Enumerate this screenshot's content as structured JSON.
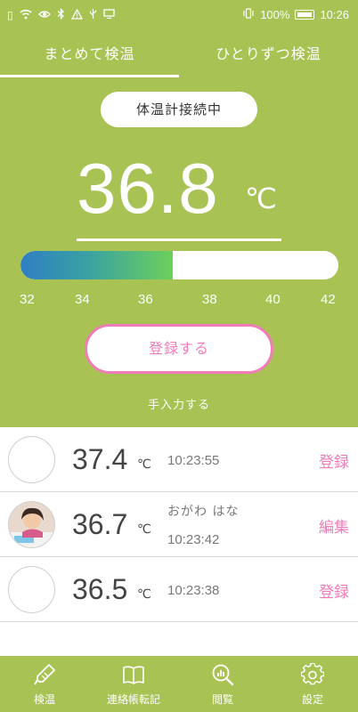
{
  "status_bar": {
    "battery": "100%",
    "time": "10:26",
    "left_icons": [
      "sim-icon",
      "wifi-icon",
      "eye-icon",
      "bluetooth-icon",
      "warning-icon",
      "usb-icon",
      "screen-icon"
    ],
    "right_icons": [
      "vibrate-icon",
      "battery-icon"
    ]
  },
  "tabs": [
    {
      "label": "まとめて検温",
      "active": true
    },
    {
      "label": "ひとりずつ検温",
      "active": false
    }
  ],
  "connection_status": "体温計接続中",
  "reading": {
    "value": "36.8",
    "unit": "℃",
    "scale_min": 32,
    "scale_max": 42,
    "scale_ticks": [
      "32",
      "34",
      "36",
      "38",
      "40",
      "42"
    ],
    "fill_fraction": 0.48
  },
  "register_button": "登録する",
  "manual_input": "手入力する",
  "records": [
    {
      "temp": "37.4",
      "unit": "℃",
      "name": "",
      "time": "10:23:55",
      "action": "登録",
      "has_photo": false
    },
    {
      "temp": "36.7",
      "unit": "℃",
      "name": "おがわ はな",
      "time": "10:23:42",
      "action": "編集",
      "has_photo": true
    },
    {
      "temp": "36.5",
      "unit": "℃",
      "name": "",
      "time": "10:23:38",
      "action": "登録",
      "has_photo": false
    }
  ],
  "bottom_nav": [
    {
      "label": "検温",
      "icon": "thermometer-icon",
      "active": true
    },
    {
      "label": "連絡帳転記",
      "icon": "book-icon",
      "active": false
    },
    {
      "label": "閲覧",
      "icon": "chart-search-icon",
      "active": false
    },
    {
      "label": "設定",
      "icon": "gear-icon",
      "active": false
    }
  ],
  "colors": {
    "brand_green": "#a8c253",
    "accent_pink": "#f07cb8",
    "gauge_start": "#2f7fc2",
    "gauge_end": "#6cd05b"
  }
}
